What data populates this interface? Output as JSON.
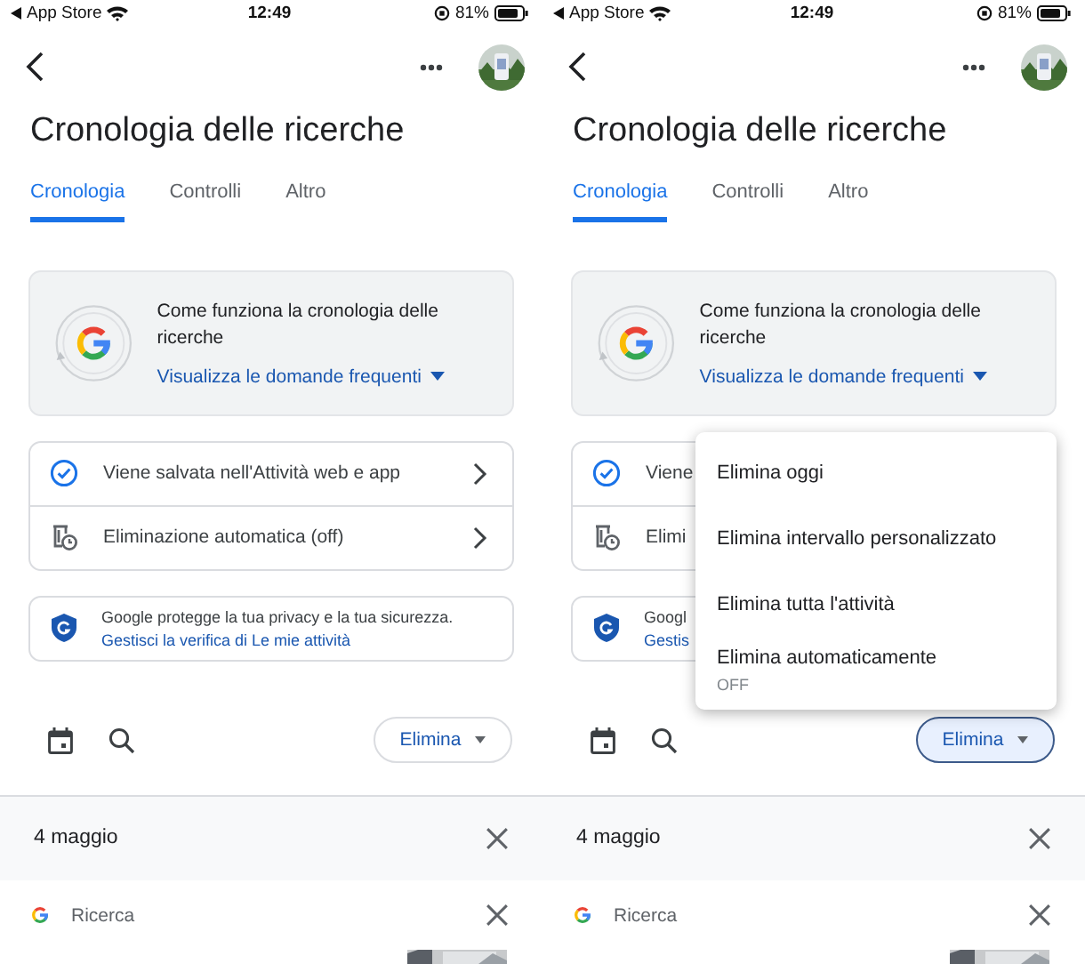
{
  "screens": [
    {
      "status": {
        "carrier": "App Store",
        "time": "12:49",
        "battery": "81%"
      },
      "title": "Cronologia delle ricerche",
      "tabs": [
        {
          "label": "Cronologia",
          "selected": true
        },
        {
          "label": "Controlli",
          "selected": false
        },
        {
          "label": "Altro",
          "selected": false
        }
      ],
      "info": {
        "text": "Come funziona la cronologia delle ricerche",
        "link": "Visualizza le domande frequenti"
      },
      "settings": [
        {
          "kind": "check",
          "label": "Viene salvata nell'Attività web e app"
        },
        {
          "kind": "auto-delete",
          "label": "Eliminazione automatica (off)"
        }
      ],
      "privacy": {
        "text": "Google protegge la tua privacy e la tua sicurezza.",
        "link": "Gestisci la verifica di Le mie attività"
      },
      "delete_button": {
        "label": "Elimina",
        "selected": false
      },
      "day": "4 maggio",
      "result": "Ricerca"
    },
    {
      "status": {
        "carrier": "App Store",
        "time": "12:49",
        "battery": "81%"
      },
      "title": "Cronologia delle ricerche",
      "tabs": [
        {
          "label": "Cronologia",
          "selected": true
        },
        {
          "label": "Controlli",
          "selected": false
        },
        {
          "label": "Altro",
          "selected": false
        }
      ],
      "info": {
        "text": "Come funziona la cronologia delle ricerche",
        "link": "Visualizza le domande frequenti"
      },
      "settings": [
        {
          "kind": "check",
          "label": "Viene"
        },
        {
          "kind": "auto-delete",
          "label": "Elimi"
        }
      ],
      "privacy": {
        "text": "Googl",
        "link": "Gestis"
      },
      "delete_button": {
        "label": "Elimina",
        "selected": true
      },
      "day": "4 maggio",
      "result": "Ricerca",
      "menu": [
        {
          "label": "Elimina oggi"
        },
        {
          "label": "Elimina intervallo personalizzato"
        },
        {
          "label": "Elimina tutta l'attività"
        },
        {
          "label": "Elimina automaticamente",
          "sublabel": "OFF"
        }
      ]
    }
  ]
}
